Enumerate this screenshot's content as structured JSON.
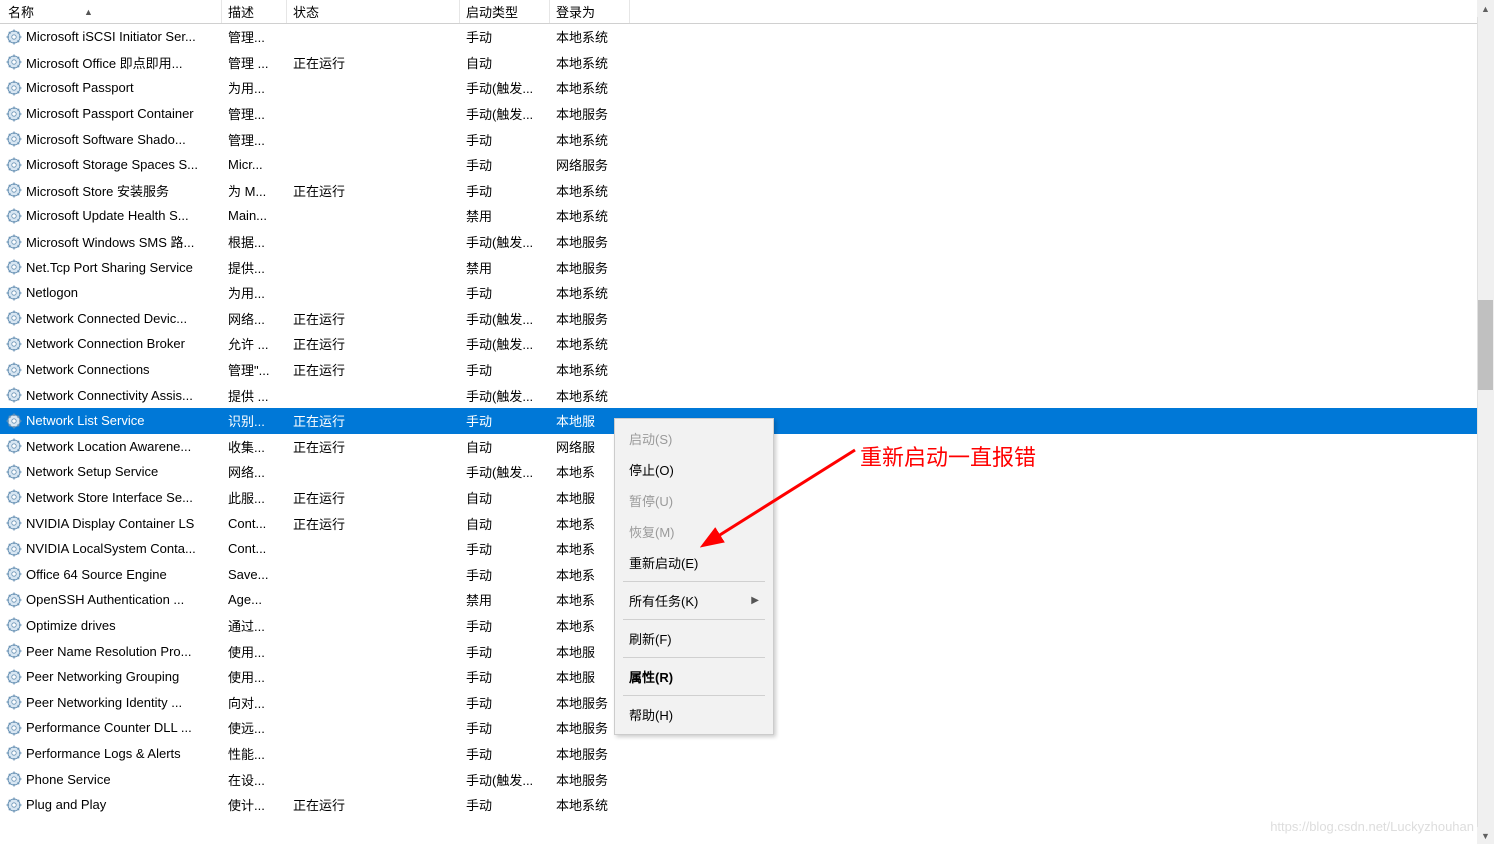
{
  "columns": {
    "name": "名称",
    "desc": "描述",
    "status": "状态",
    "start": "启动类型",
    "login": "登录为"
  },
  "sort_indicator": "▲",
  "services": [
    {
      "name": "Microsoft iSCSI Initiator Ser...",
      "desc": "管理...",
      "status": "",
      "start": "手动",
      "login": "本地系统"
    },
    {
      "name": "Microsoft Office 即点即用...",
      "desc": "管理 ...",
      "status": "正在运行",
      "start": "自动",
      "login": "本地系统"
    },
    {
      "name": "Microsoft Passport",
      "desc": "为用...",
      "status": "",
      "start": "手动(触发...",
      "login": "本地系统"
    },
    {
      "name": "Microsoft Passport Container",
      "desc": "管理...",
      "status": "",
      "start": "手动(触发...",
      "login": "本地服务"
    },
    {
      "name": "Microsoft Software Shado...",
      "desc": "管理...",
      "status": "",
      "start": "手动",
      "login": "本地系统"
    },
    {
      "name": "Microsoft Storage Spaces S...",
      "desc": "Micr...",
      "status": "",
      "start": "手动",
      "login": "网络服务"
    },
    {
      "name": "Microsoft Store 安装服务",
      "desc": "为 M...",
      "status": "正在运行",
      "start": "手动",
      "login": "本地系统"
    },
    {
      "name": "Microsoft Update Health S...",
      "desc": "Main...",
      "status": "",
      "start": "禁用",
      "login": "本地系统"
    },
    {
      "name": "Microsoft Windows SMS 路...",
      "desc": "根据...",
      "status": "",
      "start": "手动(触发...",
      "login": "本地服务"
    },
    {
      "name": "Net.Tcp Port Sharing Service",
      "desc": "提供...",
      "status": "",
      "start": "禁用",
      "login": "本地服务"
    },
    {
      "name": "Netlogon",
      "desc": "为用...",
      "status": "",
      "start": "手动",
      "login": "本地系统"
    },
    {
      "name": "Network Connected Devic...",
      "desc": "网络...",
      "status": "正在运行",
      "start": "手动(触发...",
      "login": "本地服务"
    },
    {
      "name": "Network Connection Broker",
      "desc": "允许 ...",
      "status": "正在运行",
      "start": "手动(触发...",
      "login": "本地系统"
    },
    {
      "name": "Network Connections",
      "desc": "管理\"...",
      "status": "正在运行",
      "start": "手动",
      "login": "本地系统"
    },
    {
      "name": "Network Connectivity Assis...",
      "desc": "提供 ...",
      "status": "",
      "start": "手动(触发...",
      "login": "本地系统"
    },
    {
      "name": "Network List Service",
      "desc": "识别...",
      "status": "正在运行",
      "start": "手动",
      "login": "本地服",
      "selected": true
    },
    {
      "name": "Network Location Awarene...",
      "desc": "收集...",
      "status": "正在运行",
      "start": "自动",
      "login": "网络服"
    },
    {
      "name": "Network Setup Service",
      "desc": "网络...",
      "status": "",
      "start": "手动(触发...",
      "login": "本地系"
    },
    {
      "name": "Network Store Interface Se...",
      "desc": "此服...",
      "status": "正在运行",
      "start": "自动",
      "login": "本地服"
    },
    {
      "name": "NVIDIA Display Container LS",
      "desc": "Cont...",
      "status": "正在运行",
      "start": "自动",
      "login": "本地系"
    },
    {
      "name": "NVIDIA LocalSystem Conta...",
      "desc": "Cont...",
      "status": "",
      "start": "手动",
      "login": "本地系"
    },
    {
      "name": "Office 64 Source Engine",
      "desc": "Save...",
      "status": "",
      "start": "手动",
      "login": "本地系"
    },
    {
      "name": "OpenSSH Authentication ...",
      "desc": "Age...",
      "status": "",
      "start": "禁用",
      "login": "本地系"
    },
    {
      "name": "Optimize drives",
      "desc": "通过...",
      "status": "",
      "start": "手动",
      "login": "本地系"
    },
    {
      "name": "Peer Name Resolution Pro...",
      "desc": "使用...",
      "status": "",
      "start": "手动",
      "login": "本地服"
    },
    {
      "name": "Peer Networking Grouping",
      "desc": "使用...",
      "status": "",
      "start": "手动",
      "login": "本地服"
    },
    {
      "name": "Peer Networking Identity ...",
      "desc": "向对...",
      "status": "",
      "start": "手动",
      "login": "本地服务"
    },
    {
      "name": "Performance Counter DLL ...",
      "desc": "使远...",
      "status": "",
      "start": "手动",
      "login": "本地服务"
    },
    {
      "name": "Performance Logs & Alerts",
      "desc": "性能...",
      "status": "",
      "start": "手动",
      "login": "本地服务"
    },
    {
      "name": "Phone Service",
      "desc": "在设...",
      "status": "",
      "start": "手动(触发...",
      "login": "本地服务"
    },
    {
      "name": "Plug and Play",
      "desc": "使计...",
      "status": "正在运行",
      "start": "手动",
      "login": "本地系统"
    }
  ],
  "context_menu": {
    "start": "启动(S)",
    "stop": "停止(O)",
    "pause": "暂停(U)",
    "resume": "恢复(M)",
    "restart": "重新启动(E)",
    "all_tasks": "所有任务(K)",
    "refresh": "刷新(F)",
    "properties": "属性(R)",
    "help": "帮助(H)"
  },
  "annotation": "重新启动一直报错",
  "watermark": "https://blog.csdn.net/Luckyzhouhan"
}
